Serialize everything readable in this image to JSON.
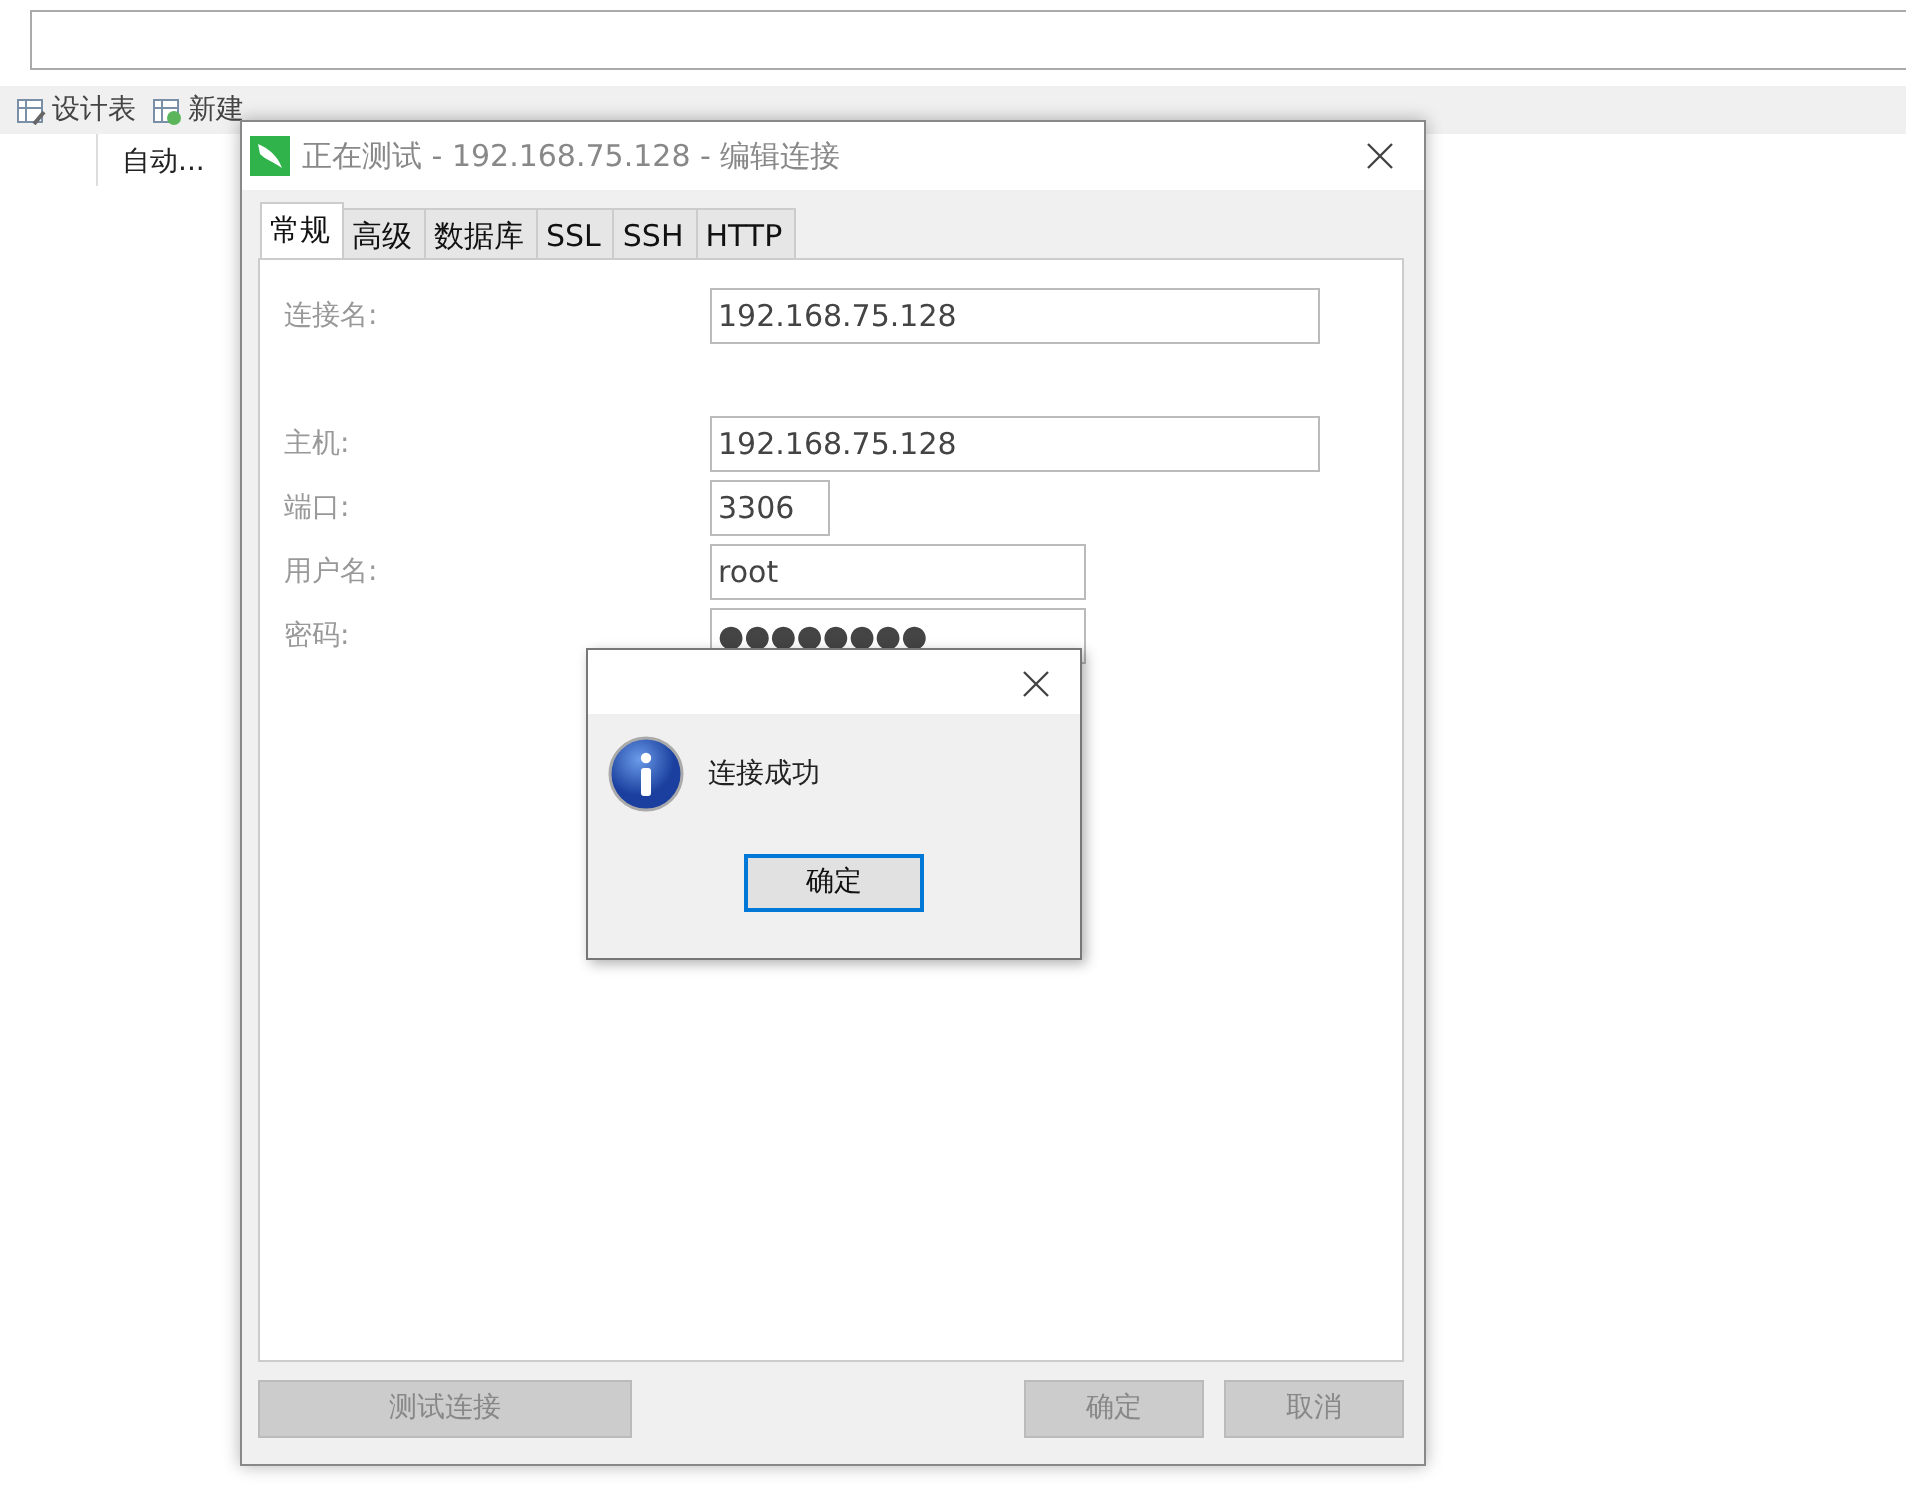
{
  "background": {
    "toolbar": [
      {
        "label": "设计表",
        "kind": "design"
      },
      {
        "label": "新建",
        "kind": "new"
      }
    ],
    "column_header": "自动..."
  },
  "dialog": {
    "title": "正在测试 - 192.168.75.128 - 编辑连接",
    "tabs": [
      {
        "label": "常规",
        "selected": true
      },
      {
        "label": "高级",
        "selected": false
      },
      {
        "label": "数据库",
        "selected": false
      },
      {
        "label": "SSL",
        "selected": false
      },
      {
        "label": "SSH",
        "selected": false
      },
      {
        "label": "HTTP",
        "selected": false
      }
    ],
    "field_groups": [
      [
        {
          "label": "连接名:",
          "value": "192.168.75.128",
          "kind": "wide"
        }
      ],
      [
        {
          "label": "主机:",
          "value": "192.168.75.128",
          "kind": "wide"
        },
        {
          "label": "端口:",
          "value": "3306",
          "kind": "short"
        },
        {
          "label": "用户名:",
          "value": "root",
          "kind": "medium"
        },
        {
          "label": "密码:",
          "value": "●●●●●●●●",
          "kind": "medium"
        }
      ]
    ],
    "buttons": [
      {
        "label": "测试连接",
        "disabled": true
      },
      {
        "label": "确定",
        "disabled": true
      },
      {
        "label": "取消",
        "disabled": true
      }
    ]
  },
  "message_box": {
    "message": "连接成功",
    "button": "确定"
  }
}
